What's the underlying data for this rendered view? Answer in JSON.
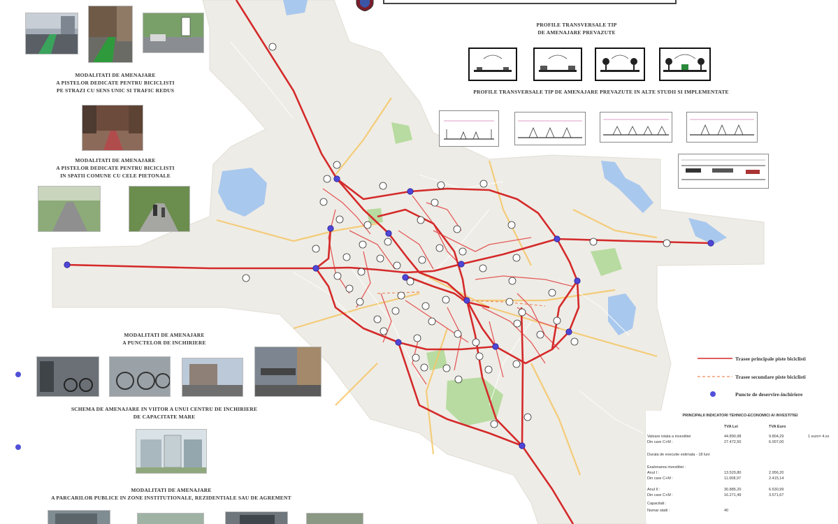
{
  "headings": {
    "profiles_planned": [
      "PROFILE TRANSVERSALE TIP",
      "DE AMENAJARE PREVAZUTE"
    ],
    "profiles_other": "PROFILE TRANSVERSALE TIP DE AMENAJARE PREVAZUTE IN ALTE STUDII SI IMPLEMENTATE",
    "section_oneway": [
      "MODALITATI DE AMENAJARE",
      "A PISTELOR DEDICATE PENTRU BICICLISTI",
      "PE STRAZI CU SENS UNIC SI TRAFIC REDUS"
    ],
    "section_shared": [
      "MODALITATI DE AMENAJARE",
      "A PISTELOR DEDICATE PENTRU BICICLISTI",
      "IN SPATII COMUNE CU CELE PIETONALE"
    ],
    "section_points": [
      "MODALITATI DE AMENAJARE",
      "A PUNCTELOR DE INCHIRIERE"
    ],
    "section_center": [
      "SCHEMA DE AMENAJARE IN VIITOR A UNUI CENTRU DE INCHIRIERE",
      "DE CAPACITATE MARE"
    ],
    "section_parking": [
      "MODALITATI DE AMENAJARE",
      "A PARCARILOR PUBLICE IN ZONE INSTITUTIONALE, REZIDENTIALE SAU DE AGREMENT"
    ]
  },
  "legend": {
    "main": "Trasee principale piste biciclisti",
    "secondary": "Trasee secundare piste biciclisti",
    "point": "Puncte de deservire-inchiriere"
  },
  "colors": {
    "main_route": "#d42a2a",
    "secondary_route": "#e35b5b",
    "rental_point": "#4f46d8",
    "water": "#a9c8ee",
    "park": "#b7dba0",
    "land": "#eeece6",
    "major_road": "#f5c766"
  },
  "table": {
    "title": "PRINCIPALII INDICATORI TEHNICO-ECONOMICI AI INVESTITIEI",
    "columns": [
      "TVA Lei",
      "TVA Euro"
    ],
    "rows": [
      {
        "label": "Valoare totala a investitiei",
        "lei": "44.890,98",
        "euro": "9.804,29",
        "note": "1 euro= 4.xx"
      },
      {
        "label": "Din care C+M :",
        "lei": "27.472,50",
        "euro": "6.007,00",
        "note": ""
      },
      {
        "label": "Durata de executie estimata - 18 luni",
        "lei": "",
        "euro": "",
        "note": ""
      },
      {
        "label": "Esalonarea investitiei :",
        "lei": "",
        "euro": "",
        "note": ""
      },
      {
        "label": "Anul I :",
        "lei": "13.520,80",
        "euro": "2.956,20",
        "note": ""
      },
      {
        "label": "Din care C+M :",
        "lei": "11.008,97",
        "euro": "2.415,14",
        "note": ""
      },
      {
        "label": "Anul II :",
        "lei": "30.885,20",
        "euro": "6.630,99",
        "note": ""
      },
      {
        "label": "Din care C+M :",
        "lei": "16.271,49",
        "euro": "3.571,67",
        "note": ""
      },
      {
        "label": "Capacitati :",
        "lei": "",
        "euro": "",
        "note": ""
      },
      {
        "label": "Numar statii :",
        "lei": "40",
        "euro": "",
        "note": ""
      }
    ]
  }
}
